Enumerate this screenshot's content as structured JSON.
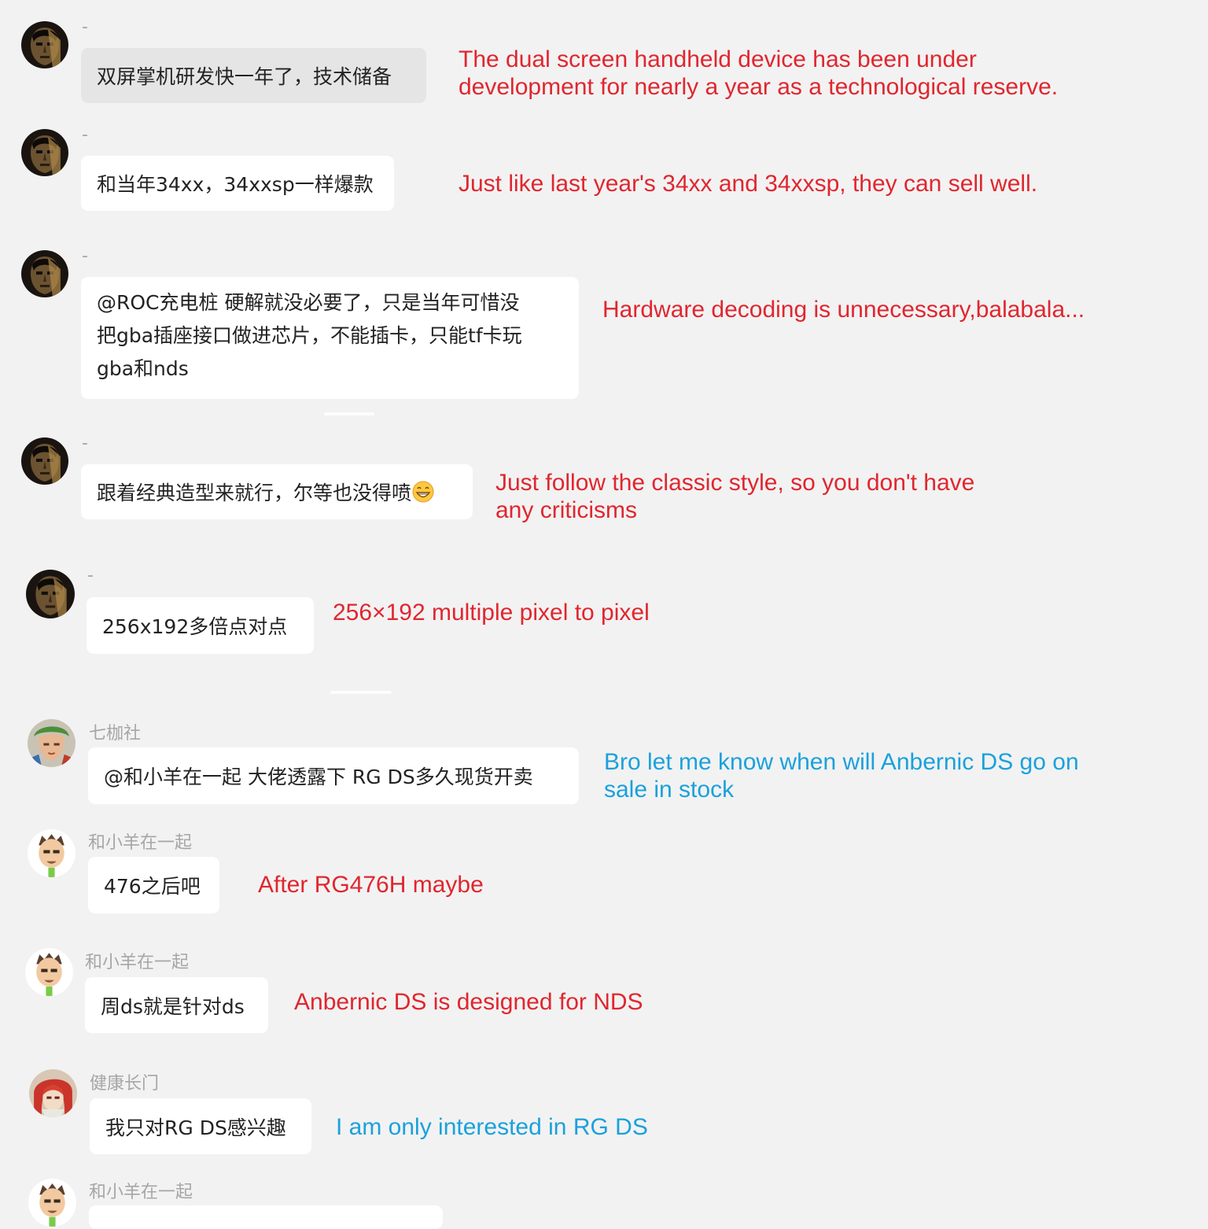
{
  "colors": {
    "background": "#f2f2f2",
    "bubble": "#ffffff",
    "bubble_highlight": "#e5e5e5",
    "translation_red": "#e0262f",
    "translation_blue": "#1aa1dc",
    "sender_name": "#a6a6a6"
  },
  "messages": [
    {
      "sender": "-",
      "avatar": "dark-portrait-avatar",
      "text": "双屏掌机研发快一年了，技术储备",
      "translation": [
        "The dual screen handheld device has been under",
        "development for nearly a year as a technological reserve."
      ],
      "translation_color": "red"
    },
    {
      "sender": "-",
      "avatar": "dark-portrait-avatar",
      "text": "和当年34xx，34xxsp一样爆款",
      "translation": [
        "Just like last year's 34xx and 34xxsp, they can sell well."
      ],
      "translation_color": "red"
    },
    {
      "sender": "-",
      "avatar": "dark-portrait-avatar",
      "text_lines": [
        "@ROC充电桩 硬解就没必要了，只是当年可惜没",
        "把gba插座接口做进芯片，不能插卡，只能tf卡玩",
        "gba和nds"
      ],
      "translation": [
        "Hardware decoding is unnecessary,balabala..."
      ],
      "translation_color": "red"
    },
    {
      "sender": "-",
      "avatar": "dark-portrait-avatar",
      "text": "跟着经典造型来就行，尔等也没得喷",
      "emoji": "grinning-emoji",
      "translation": [
        "Just follow the classic style, so you don't have",
        "any criticisms"
      ],
      "translation_color": "red"
    },
    {
      "sender": "-",
      "avatar": "dark-portrait-avatar",
      "text": "256x192多倍点对点",
      "translation": [
        "256×192  multiple  pixel to pixel"
      ],
      "translation_color": "red"
    },
    {
      "sender": "七枷社",
      "avatar": "green-hair-avatar",
      "text": "@和小羊在一起 大佬透露下 RG DS多久现货开卖",
      "translation": [
        "Bro let me know  when will Anbernic DS go on",
        "sale in stock"
      ],
      "translation_color": "blue"
    },
    {
      "sender": "和小羊在一起",
      "avatar": "cartoon-boy-avatar",
      "text": "476之后吧",
      "translation": [
        "After RG476H maybe"
      ],
      "translation_color": "red"
    },
    {
      "sender": "和小羊在一起",
      "avatar": "cartoon-boy-avatar",
      "text": "周ds就是针对ds",
      "translation": [
        "Anbernic DS is designed for NDS"
      ],
      "translation_color": "red"
    },
    {
      "sender": "健康长门",
      "avatar": "red-hair-anime-avatar",
      "text": "我只对RG DS感兴趣",
      "translation": [
        "I am only interested in RG DS"
      ],
      "translation_color": "blue"
    },
    {
      "sender": "和小羊在一起",
      "avatar": "cartoon-boy-avatar"
    }
  ]
}
